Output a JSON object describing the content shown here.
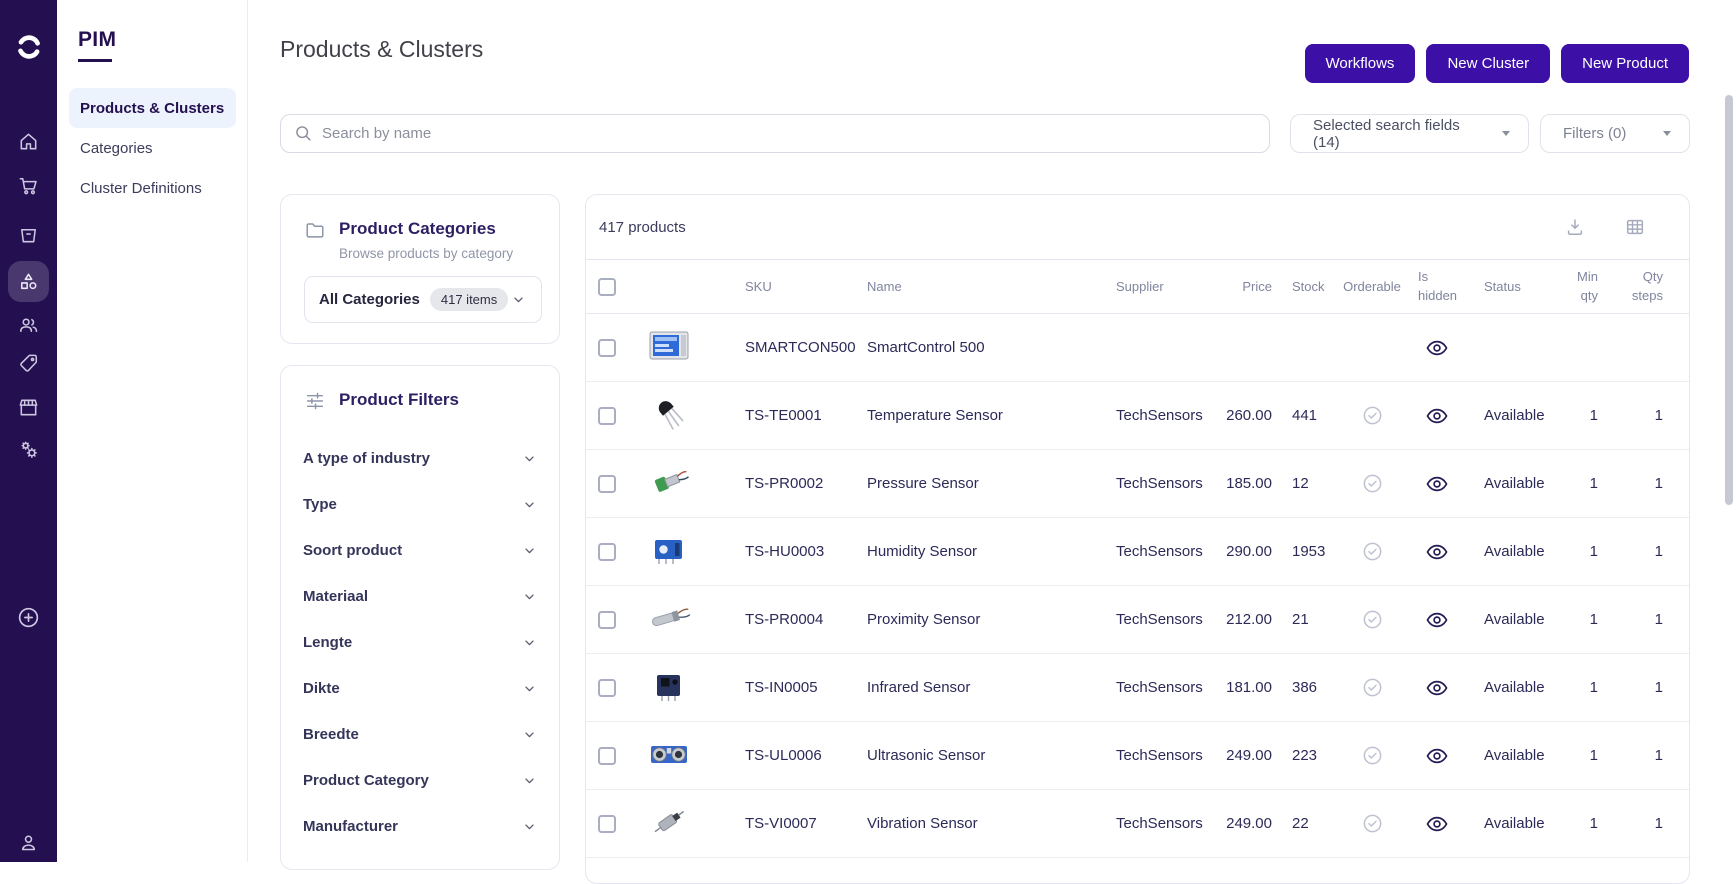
{
  "colors": {
    "accent": "#3c10a6",
    "rail_bg": "#241050",
    "active_nav_bg": "#edf3fd"
  },
  "rail": {
    "icons": [
      "logo",
      "home",
      "cart",
      "basket",
      "clusters",
      "users",
      "tag",
      "store",
      "settings",
      "add",
      "account"
    ],
    "active_icon": "clusters"
  },
  "sidebar": {
    "brand": "PIM",
    "items": [
      {
        "label": "Products & Clusters",
        "active": true
      },
      {
        "label": "Categories",
        "active": false
      },
      {
        "label": "Cluster Definitions",
        "active": false
      }
    ]
  },
  "header": {
    "title": "Products & Clusters",
    "workflows_label": "Workflows",
    "new_cluster_label": "New Cluster",
    "new_product_label": "New Product"
  },
  "toolbar": {
    "search_placeholder": "Search by name",
    "fields_dropdown": "Selected search fields (14)",
    "filters_dropdown": "Filters (0)"
  },
  "categories_panel": {
    "title": "Product Categories",
    "subtitle": "Browse products by category",
    "selector_label": "All Categories",
    "badge": "417 items"
  },
  "filters_panel": {
    "title": "Product Filters",
    "filters": [
      "A type of industry",
      "Type",
      "Soort product",
      "Materiaal",
      "Lengte",
      "Dikte",
      "Breedte",
      "Product Category",
      "Manufacturer"
    ]
  },
  "products": {
    "count_label": "417 products",
    "columns": {
      "sku": "SKU",
      "name": "Name",
      "supplier": "Supplier",
      "price": "Price",
      "stock": "Stock",
      "orderable": "Orderable",
      "is_hidden_1": "Is",
      "is_hidden_2": "hidden",
      "status": "Status",
      "min_qty_1": "Min",
      "min_qty_2": "qty",
      "qty_steps_1": "Qty",
      "qty_steps_2": "steps"
    },
    "rows": [
      {
        "sku": "SMARTCON500",
        "name": "SmartControl 500",
        "supplier": "",
        "price": "",
        "stock": "",
        "orderable": false,
        "status": "",
        "min_qty": "",
        "qty_steps": "",
        "thumb": "control-panel"
      },
      {
        "sku": "TS-TE0001",
        "name": "Temperature Sensor",
        "supplier": "TechSensors",
        "price": "260.00",
        "stock": "441",
        "orderable": true,
        "status": "Available",
        "min_qty": "1",
        "qty_steps": "1",
        "thumb": "transistor"
      },
      {
        "sku": "TS-PR0002",
        "name": "Pressure Sensor",
        "supplier": "TechSensors",
        "price": "185.00",
        "stock": "12",
        "orderable": true,
        "status": "Available",
        "min_qty": "1",
        "qty_steps": "1",
        "thumb": "pressure"
      },
      {
        "sku": "TS-HU0003",
        "name": "Humidity Sensor",
        "supplier": "TechSensors",
        "price": "290.00",
        "stock": "1953",
        "orderable": true,
        "status": "Available",
        "min_qty": "1",
        "qty_steps": "1",
        "thumb": "humidity"
      },
      {
        "sku": "TS-PR0004",
        "name": "Proximity Sensor",
        "supplier": "TechSensors",
        "price": "212.00",
        "stock": "21",
        "orderable": true,
        "status": "Available",
        "min_qty": "1",
        "qty_steps": "1",
        "thumb": "proximity"
      },
      {
        "sku": "TS-IN0005",
        "name": "Infrared Sensor",
        "supplier": "TechSensors",
        "price": "181.00",
        "stock": "386",
        "orderable": true,
        "status": "Available",
        "min_qty": "1",
        "qty_steps": "1",
        "thumb": "infrared"
      },
      {
        "sku": "TS-UL0006",
        "name": "Ultrasonic Sensor",
        "supplier": "TechSensors",
        "price": "249.00",
        "stock": "223",
        "orderable": true,
        "status": "Available",
        "min_qty": "1",
        "qty_steps": "1",
        "thumb": "ultrasonic"
      },
      {
        "sku": "TS-VI0007",
        "name": "Vibration Sensor",
        "supplier": "TechSensors",
        "price": "249.00",
        "stock": "22",
        "orderable": true,
        "status": "Available",
        "min_qty": "1",
        "qty_steps": "1",
        "thumb": "vibration"
      }
    ]
  }
}
